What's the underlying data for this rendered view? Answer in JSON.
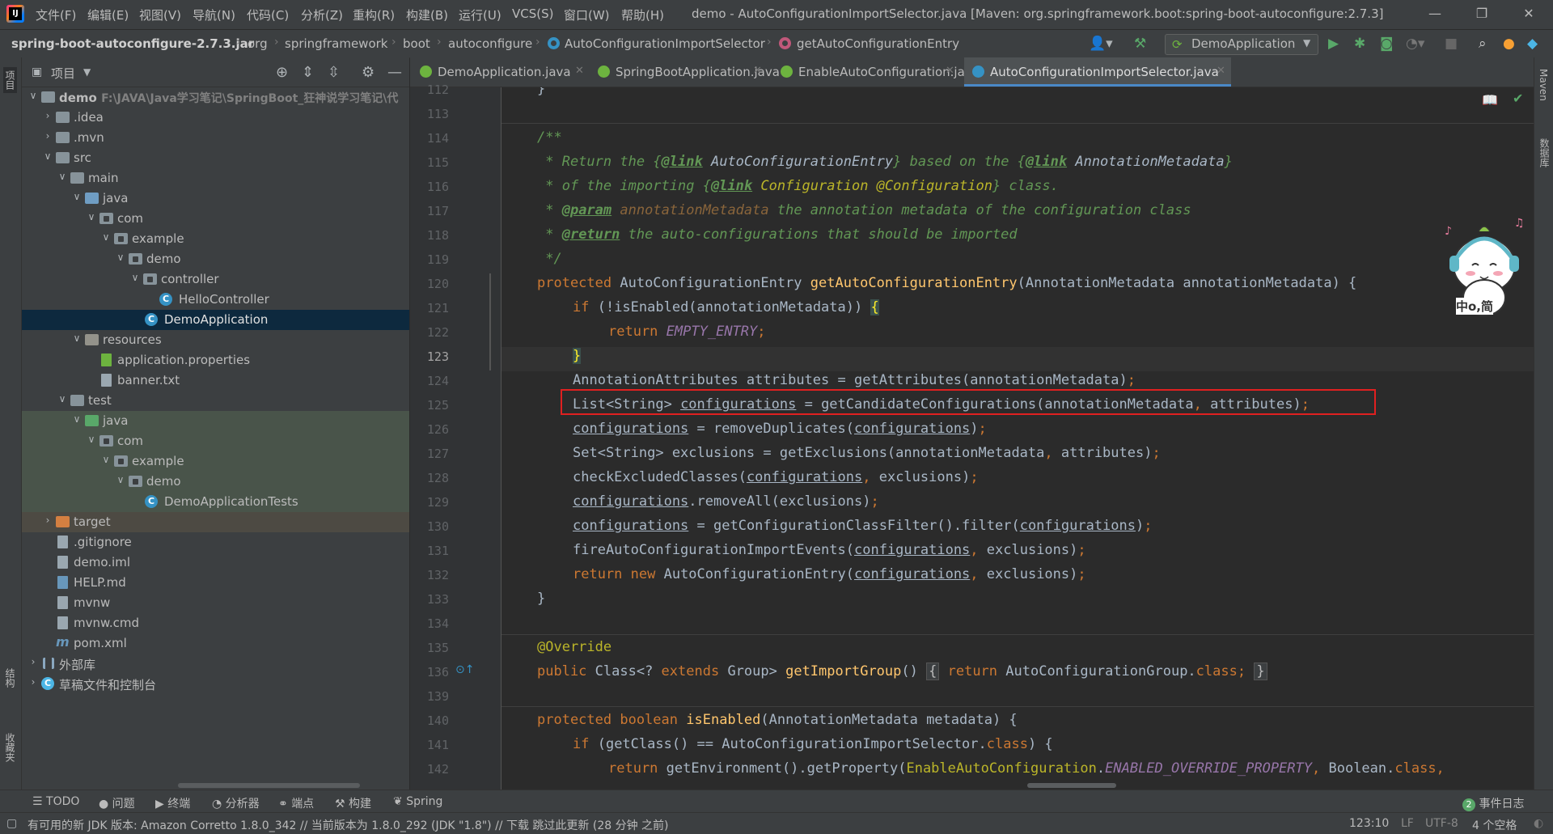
{
  "window": {
    "title": "demo - AutoConfigurationImportSelector.java [Maven: org.springframework.boot:spring-boot-autoconfigure:2.7.3]",
    "logo_text": "IJ"
  },
  "menu": [
    "文件(F)",
    "编辑(E)",
    "视图(V)",
    "导航(N)",
    "代码(C)",
    "分析(Z)",
    "重构(R)",
    "构建(B)",
    "运行(U)",
    "VCS(S)",
    "窗口(W)",
    "帮助(H)"
  ],
  "breadcrumbs": [
    "spring-boot-autoconfigure-2.7.3.jar",
    "org",
    "springframework",
    "boot",
    "autoconfigure",
    "AutoConfigurationImportSelector",
    "getAutoConfigurationEntry"
  ],
  "run_config": "DemoApplication",
  "project_panel": {
    "title": "项目",
    "tree": [
      {
        "label": "demo",
        "path": "F:\\JAVA\\Java学习笔记\\SpringBoot_狂神说学习笔记\\代",
        "icon": "folder"
      },
      {
        "label": ".idea",
        "icon": "folder"
      },
      {
        "label": ".mvn",
        "icon": "folder"
      },
      {
        "label": "src",
        "icon": "folder"
      },
      {
        "label": "main",
        "icon": "folder"
      },
      {
        "label": "java",
        "icon": "folder-source"
      },
      {
        "label": "com",
        "icon": "package"
      },
      {
        "label": "example",
        "icon": "package"
      },
      {
        "label": "demo",
        "icon": "package"
      },
      {
        "label": "controller",
        "icon": "package"
      },
      {
        "label": "HelloController",
        "icon": "class"
      },
      {
        "label": "DemoApplication",
        "icon": "spring-class"
      },
      {
        "label": "resources",
        "icon": "folder-resources"
      },
      {
        "label": "application.properties",
        "icon": "properties-file"
      },
      {
        "label": "banner.txt",
        "icon": "text-file"
      },
      {
        "label": "test",
        "icon": "folder"
      },
      {
        "label": "java",
        "icon": "folder-test"
      },
      {
        "label": "com",
        "icon": "package"
      },
      {
        "label": "example",
        "icon": "package"
      },
      {
        "label": "demo",
        "icon": "package"
      },
      {
        "label": "DemoApplicationTests",
        "icon": "class"
      },
      {
        "label": "target",
        "icon": "folder-excluded"
      },
      {
        "label": ".gitignore",
        "icon": "text-file"
      },
      {
        "label": "demo.iml",
        "icon": "text-file"
      },
      {
        "label": "HELP.md",
        "icon": "markdown-file"
      },
      {
        "label": "mvnw",
        "icon": "script-file"
      },
      {
        "label": "mvnw.cmd",
        "icon": "text-file"
      },
      {
        "label": "pom.xml",
        "icon": "maven-file"
      },
      {
        "label": "外部库",
        "icon": "library"
      },
      {
        "label": "草稿文件和控制台",
        "icon": "scratch"
      }
    ]
  },
  "tabs": [
    {
      "label": "DemoApplication.java",
      "active": false
    },
    {
      "label": "SpringBootApplication.java",
      "active": false
    },
    {
      "label": "EnableAutoConfiguration.java",
      "active": false
    },
    {
      "label": "AutoConfigurationImportSelector.java",
      "active": true
    }
  ],
  "editor": {
    "line_numbers": [
      "112",
      "113",
      "114",
      "115",
      "116",
      "117",
      "118",
      "119",
      "120",
      "121",
      "122",
      "123",
      "124",
      "125",
      "126",
      "127",
      "128",
      "129",
      "130",
      "131",
      "132",
      "133",
      "134",
      "135",
      "136",
      "139",
      "140",
      "141",
      "142"
    ],
    "current_line": "123",
    "highlighted_line": "125"
  },
  "left_strip": {
    "project": "项目",
    "structure": "结构",
    "favorites": "收藏夹"
  },
  "right_strip": {
    "maven": "Maven",
    "database": "数据库"
  },
  "sticker_text": "中o,简",
  "toolwindows": [
    "TODO",
    "问题",
    "终端",
    "分析器",
    "端点",
    "构建",
    "Spring"
  ],
  "event_log": {
    "count": "2",
    "label": "事件日志"
  },
  "status": {
    "message": "有可用的新 JDK 版本: Amazon Corretto 1.8.0_342 // 当前版本为 1.8.0_292 (JDK \"1.8\") // 下载   跳过此更新 (28 分钟 之前)",
    "position": "123:10",
    "line_sep": "LF",
    "encoding": "UTF-8",
    "indent": "4 个空格"
  },
  "colors": {
    "accent": "#4a88c7",
    "highlight_box": "#e02020",
    "selection": "#0d293e"
  }
}
